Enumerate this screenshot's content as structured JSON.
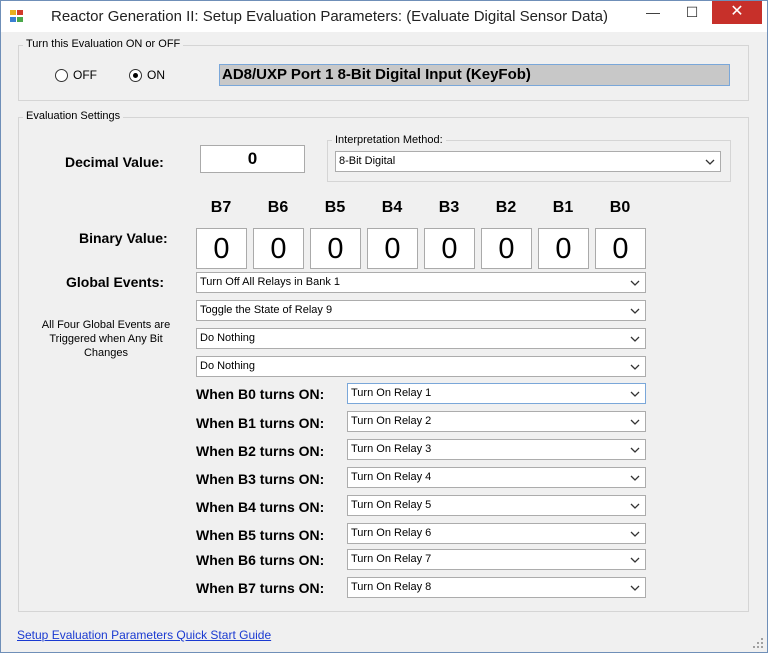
{
  "window": {
    "title": "Reactor Generation II: Setup Evaluation Parameters: (Evaluate Digital Sensor Data)",
    "minimize_glyph": "—",
    "maximize_glyph": "☐",
    "close_glyph": "✕"
  },
  "on_off_group": {
    "title": "Turn this Evaluation ON or OFF",
    "off_label": "OFF",
    "on_label": "ON",
    "selected": "ON",
    "sensor_name": "AD8/UXP Port 1 8-Bit Digital Input (KeyFob)"
  },
  "settings_group": {
    "title": "Evaluation Settings",
    "decimal_label": "Decimal Value:",
    "decimal_value": "0",
    "interpretation": {
      "title": "Interpretation Method:",
      "selected": "8-Bit Digital"
    },
    "binary_label": "Binary Value:",
    "bit_headers": [
      "B7",
      "B6",
      "B5",
      "B4",
      "B3",
      "B2",
      "B1",
      "B0"
    ],
    "bit_values": [
      "0",
      "0",
      "0",
      "0",
      "0",
      "0",
      "0",
      "0"
    ],
    "global_events_label": "Global Events:",
    "global_events": [
      "Turn Off All Relays in Bank 1",
      "Toggle the State of Relay 9",
      "Do Nothing",
      "Do Nothing"
    ],
    "global_note": "All Four Global Events are Triggered when Any Bit Changes",
    "bit_events": [
      {
        "label": "When B0 turns ON:",
        "action": "Turn On Relay 1"
      },
      {
        "label": "When B1 turns ON:",
        "action": "Turn On Relay 2"
      },
      {
        "label": "When B2 turns ON:",
        "action": "Turn On Relay 3"
      },
      {
        "label": "When B3 turns ON:",
        "action": "Turn On Relay 4"
      },
      {
        "label": "When B4 turns ON:",
        "action": "Turn On Relay 5"
      },
      {
        "label": "When B5 turns ON:",
        "action": "Turn On Relay 6"
      },
      {
        "label": "When B6 turns ON:",
        "action": "Turn On Relay 7"
      },
      {
        "label": "When B7 turns ON:",
        "action": "Turn On Relay 8"
      }
    ]
  },
  "footer": {
    "guide_link": "Setup Evaluation Parameters Quick Start Guide"
  },
  "colors": {
    "close_button": "#c7302a",
    "link": "#1a3ad1",
    "focus_border": "#7aa7d9"
  }
}
